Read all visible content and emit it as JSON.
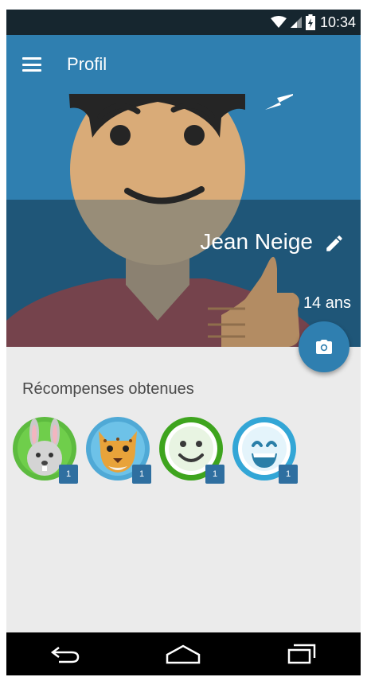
{
  "status_bar": {
    "time": "10:34"
  },
  "app_bar": {
    "title": "Profil"
  },
  "profile": {
    "name": "Jean Neige",
    "age": "14 ans"
  },
  "rewards": {
    "title": "Récompenses obtenues",
    "items": [
      {
        "icon": "rabbit-badge-icon",
        "count": "1"
      },
      {
        "icon": "leopard-badge-icon",
        "count": "1"
      },
      {
        "icon": "smiley-badge-icon",
        "count": "1"
      },
      {
        "icon": "laughing-face-badge-icon",
        "count": "1"
      }
    ]
  },
  "colors": {
    "app_bar": "#2f7fb0",
    "hero_dark": "#1f5779",
    "background": "#ebebeb",
    "badge_count": "#2f6fa0"
  }
}
